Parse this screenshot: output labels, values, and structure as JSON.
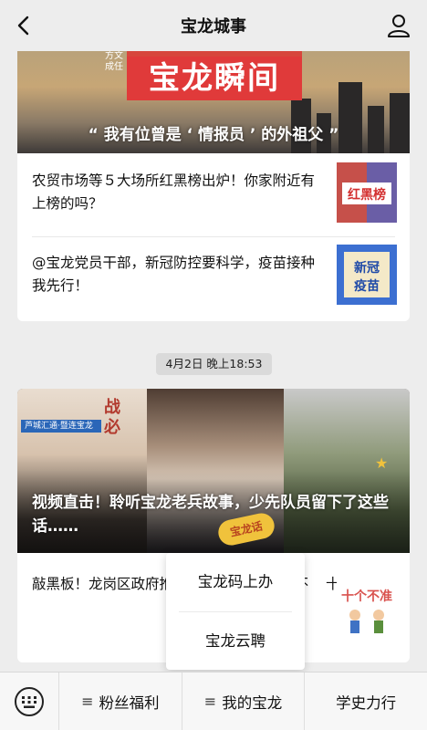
{
  "header": {
    "title": "宝龙城事"
  },
  "article1": {
    "banner_title": "宝龙瞬间",
    "banner_side": "方文成任",
    "banner_caption": "“ 我有位曾是 ‘ 情报员 ’ 的外祖父 ”",
    "items": [
      {
        "text": "农贸市场等５大场所红黑榜出炉！你家附近有上榜的吗？",
        "thumb_text": "红黑榜"
      },
      {
        "text": "@宝龙党员干部，新冠防控要科学，疫苗接种我先行！",
        "thumb_text": "新冠疫苗"
      }
    ]
  },
  "timestamp": "4月2日 晚上18:53",
  "article2": {
    "hero_caption": "视频直击！聆听宝龙老兵故事，少先队员留下了这些话……",
    "hero_tag": "芦城汇通·暨连宝龙",
    "hero_side": "战必",
    "hero_badge": "宝龙话",
    "item": {
      "text": "敲黑板！龙岗区政府推出“十个不准”“十个不",
      "suffix": "十",
      "thumb_text": "十个不准"
    }
  },
  "popup_menu": {
    "items": [
      "宝龙码上办",
      "宝龙云聘"
    ]
  },
  "bottom_menu": {
    "items": [
      {
        "label": "粉丝福利",
        "has_menu_icon": true
      },
      {
        "label": "我的宝龙",
        "has_menu_icon": true
      },
      {
        "label": "学史力行",
        "has_menu_icon": false
      }
    ]
  },
  "colors": {
    "accent_red": "#e03a3a",
    "background": "#ededed",
    "hero_badge": "#f0c23c",
    "news_tag_blue": "#2a66b8"
  },
  "icons": {
    "back": "chevron-left-icon",
    "profile": "user-icon",
    "keyboard": "keyboard-icon",
    "menu": "hamburger-icon"
  }
}
